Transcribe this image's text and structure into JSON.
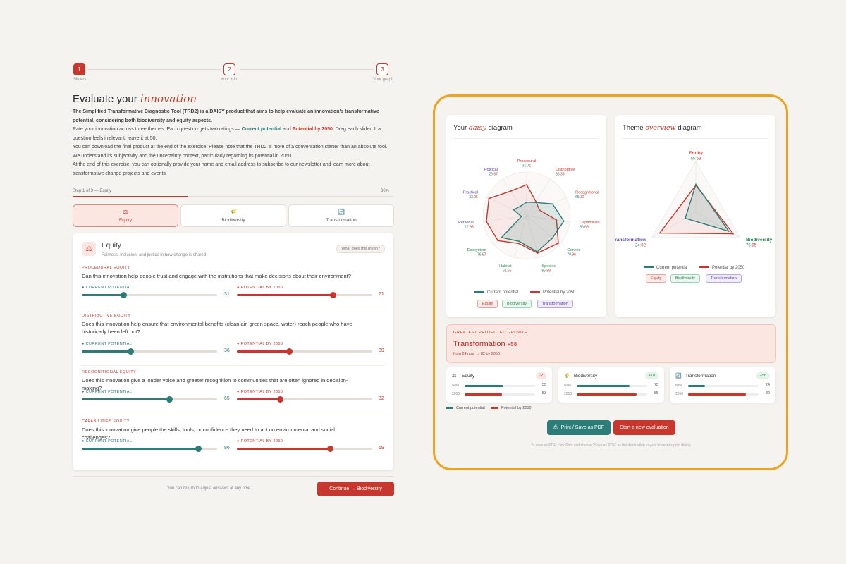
{
  "stepper": [
    {
      "num": "1",
      "label": "Sliders"
    },
    {
      "num": "2",
      "label": "Your info"
    },
    {
      "num": "3",
      "label": "Your graph"
    }
  ],
  "heading": {
    "prefix": "Evaluate your",
    "accent": "innovation"
  },
  "intro": {
    "bold": "The Simplified Transformative Diagnostic Tool (TRD2) is a DAISY product that aims to help evaluate an innovation's transformative potential, considering both biodiversity and equity aspects.",
    "rate_prefix": "Rate your innovation across three themes. Each question gets two ratings —",
    "current": "Current potential",
    "and": "and",
    "potential": "Potential by 2050",
    "rate_suffix": ". Drag each slider. If a question feels irrelevant, leave it at 50.",
    "download": "You can download the final product at the end of the exercise. Please note that the TRD2 is more of a conversation starter than an absolute tool. We understand its subjectivity and the uncertainty context, particularly regarding its potential in 2050.",
    "end": "At the end of this exercise, you can optionally provide your name and email address to subscribe to our newsletter and learn more about transformative change projects and events."
  },
  "progress": {
    "label": "Step 1 of 3 — Equity",
    "percent_text": "36%",
    "fraction": 0.36
  },
  "tabs": [
    {
      "icon": "⚖",
      "label": "Equity"
    },
    {
      "icon": "🌾",
      "label": "Biodiversity"
    },
    {
      "icon": "🔄",
      "label": "Transformation"
    }
  ],
  "section": {
    "icon": "⚖",
    "title": "Equity",
    "subtitle": "Fairness, inclusion, and justice in how change is shared",
    "help": "What does this mean?"
  },
  "slider_labels": {
    "current": "Current potential",
    "potential": "Potential by 2050"
  },
  "questions": [
    {
      "category": "Procedural equity",
      "text": "Can this innovation help people trust and engage with the institutions that make decisions about their environment?",
      "current": 31,
      "potential": 71
    },
    {
      "category": "Distributive equity",
      "text": "Does this innovation help ensure that environmental benefits (clean air, green space, water) reach people who have historically been left out?",
      "current": 36,
      "potential": 39
    },
    {
      "category": "Recognitional equity",
      "text": "Does this innovation give a louder voice and greater recognition to communities that are often ignored in decision-making?",
      "current": 65,
      "potential": 32
    },
    {
      "category": "Capabilities equity",
      "text": "Does this innovation give people the skills, tools, or confidence they need to act on environmental and social challenges?",
      "current": 86,
      "potential": 69
    }
  ],
  "footer": {
    "note": "You can return to adjust answers at any time",
    "continue": "Continue → Biodiversity"
  },
  "daisy": {
    "title_prefix": "Your",
    "title_accent": "daisy",
    "title_suffix": "diagram",
    "axes": [
      {
        "label": "Procedural",
        "current": 31,
        "potential": 71,
        "theme": "equity"
      },
      {
        "label": "Distributive",
        "current": 36,
        "potential": 39,
        "theme": "equity"
      },
      {
        "label": "Recognitional",
        "current": 65,
        "potential": 32,
        "theme": "equity"
      },
      {
        "label": "Capabilities",
        "current": 86,
        "potential": 69,
        "theme": "equity"
      },
      {
        "label": "Genetic",
        "current": 78,
        "potential": 96,
        "theme": "biodiversity"
      },
      {
        "label": "Species",
        "current": 86,
        "potential": 89,
        "theme": "biodiversity"
      },
      {
        "label": "Habitat",
        "current": 61,
        "potential": 66,
        "theme": "biodiversity"
      },
      {
        "label": "Ecosystem",
        "current": 76,
        "potential": 87,
        "theme": "biodiversity"
      },
      {
        "label": "Personal",
        "current": 12,
        "potential": 93,
        "theme": "transformation"
      },
      {
        "label": "Practical",
        "current": 33,
        "potential": 95,
        "theme": "transformation"
      },
      {
        "label": "Political",
        "current": 26,
        "potential": 67,
        "theme": "transformation"
      }
    ]
  },
  "overview": {
    "title_prefix": "Theme",
    "title_accent": "overview",
    "title_suffix": "diagram",
    "axes": [
      {
        "label": "Equity",
        "current": 55,
        "potential": 53,
        "theme": "equity"
      },
      {
        "label": "Biodiversity",
        "current": 75,
        "potential": 85,
        "theme": "biodiversity"
      },
      {
        "label": "Transformation",
        "current": 24,
        "potential": 82,
        "theme": "transformation"
      }
    ]
  },
  "legend": {
    "current": "Current potential",
    "potential": "Potential by 2050"
  },
  "chips": [
    "Equity",
    "Biodiversity",
    "Transformation"
  ],
  "growth": {
    "label": "Greatest projected growth",
    "theme": "Transformation",
    "delta": "+58",
    "detail": "from 24 now → 82 by 2050"
  },
  "minis": [
    {
      "icon": "⚖",
      "name": "Equity",
      "badge": "-2",
      "now_label": "Now",
      "future_label": "2050",
      "now": 55,
      "future": 53
    },
    {
      "icon": "🌾",
      "name": "Biodiversity",
      "badge": "+10",
      "now_label": "Now",
      "future_label": "2050",
      "now": 75,
      "future": 85
    },
    {
      "icon": "🔄",
      "name": "Transformation",
      "badge": "+58",
      "now_label": "Now",
      "future_label": "2050",
      "now": 24,
      "future": 82
    }
  ],
  "actions": {
    "print": "Print / Save as PDF",
    "restart": "Start a new evaluation"
  },
  "print_hint": "To save as PDF: click Print and choose \"Save as PDF\" as the destination in your browser's print dialog.",
  "colors": {
    "red": "#c8372d",
    "teal": "#2c7d78",
    "equity": "#c8372d",
    "biodiversity": "#2e8b57",
    "transformation": "#5b3fb0",
    "highlight": "#f0a21c"
  }
}
